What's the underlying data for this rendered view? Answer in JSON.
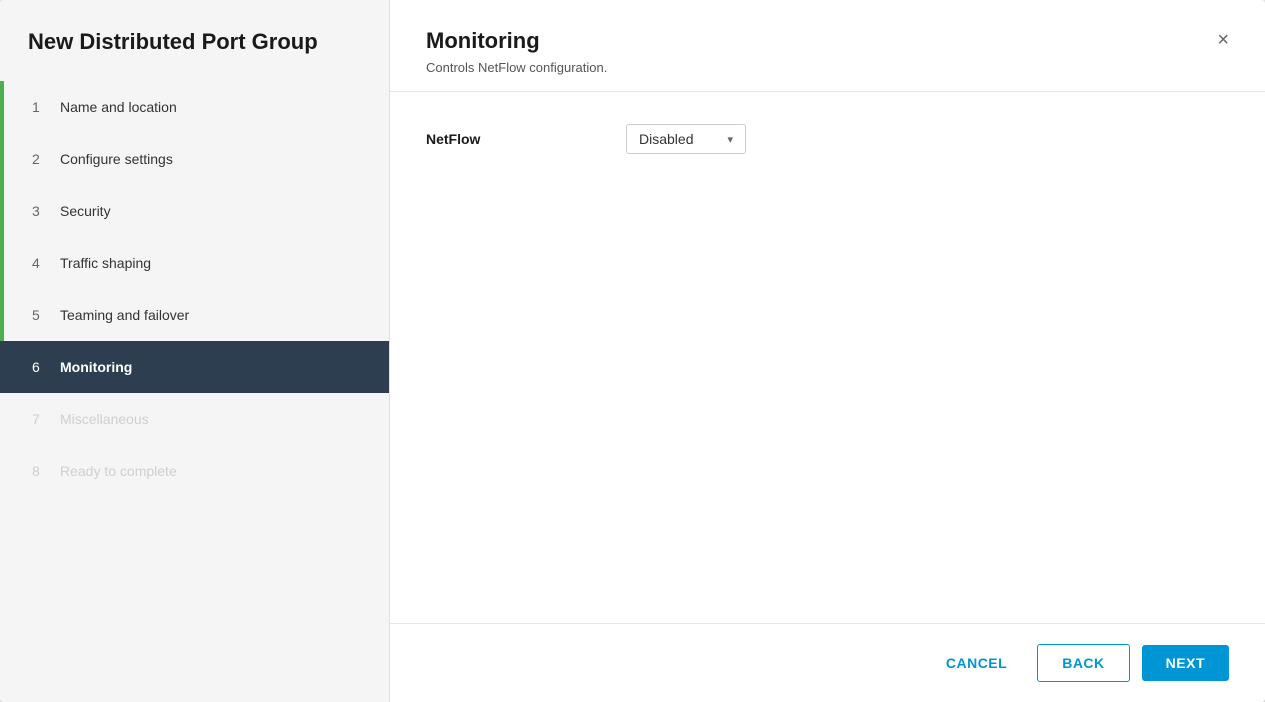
{
  "dialog": {
    "title": "New Distributed Port Group"
  },
  "sidebar": {
    "steps": [
      {
        "number": "1",
        "label": "Name and location",
        "state": "completed"
      },
      {
        "number": "2",
        "label": "Configure settings",
        "state": "completed"
      },
      {
        "number": "3",
        "label": "Security",
        "state": "completed"
      },
      {
        "number": "4",
        "label": "Traffic shaping",
        "state": "completed"
      },
      {
        "number": "5",
        "label": "Teaming and failover",
        "state": "completed"
      },
      {
        "number": "6",
        "label": "Monitoring",
        "state": "active"
      },
      {
        "number": "7",
        "label": "Miscellaneous",
        "state": "disabled"
      },
      {
        "number": "8",
        "label": "Ready to complete",
        "state": "disabled"
      }
    ]
  },
  "main": {
    "title": "Monitoring",
    "subtitle": "Controls NetFlow configuration.",
    "close_label": "×",
    "fields": [
      {
        "label": "NetFlow",
        "value": "Disabled",
        "chevron": "▾"
      }
    ]
  },
  "footer": {
    "cancel_label": "CANCEL",
    "back_label": "BACK",
    "next_label": "NEXT"
  }
}
